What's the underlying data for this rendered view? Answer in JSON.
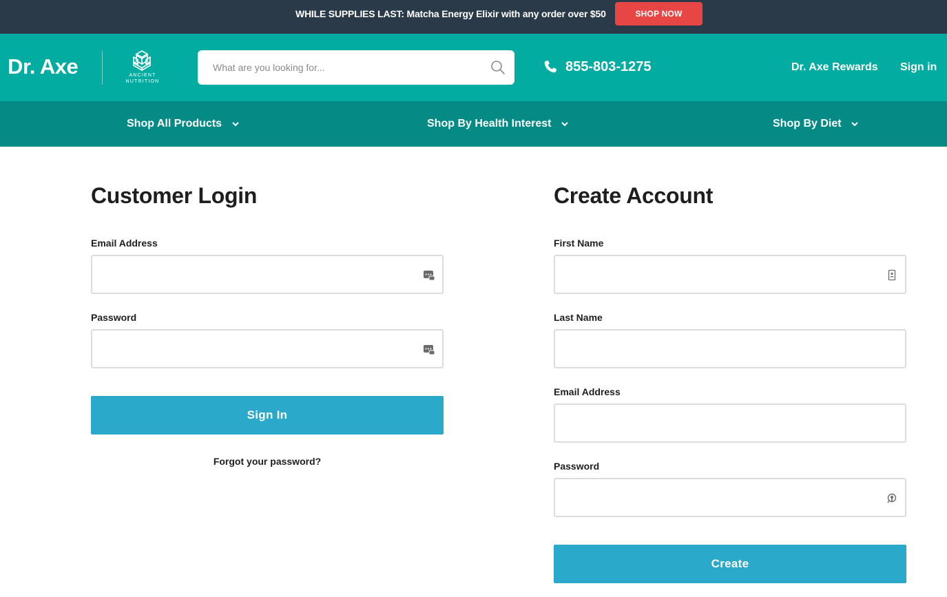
{
  "promo": {
    "text": "WHILE SUPPLIES LAST: Matcha Energy Elixir with any order over $50",
    "button_label": "SHOP NOW"
  },
  "header": {
    "logo": "Dr. Axe",
    "partner_logo_line1": "ANCIENT",
    "partner_logo_line2": "NUTRITION",
    "search_placeholder": "What are you looking for...",
    "phone": "855-803-1275",
    "rewards_link": "Dr. Axe Rewards",
    "signin_link": "Sign in"
  },
  "nav": {
    "items": [
      {
        "label": "Shop All Products"
      },
      {
        "label": "Shop By Health Interest"
      },
      {
        "label": "Shop By Diet"
      }
    ]
  },
  "login": {
    "title": "Customer Login",
    "email_label": "Email Address",
    "email_value": "",
    "password_label": "Password",
    "password_value": "",
    "submit_label": "Sign In",
    "forgot_label": "Forgot your password?"
  },
  "create": {
    "title": "Create Account",
    "first_name_label": "First Name",
    "first_name_value": "",
    "last_name_label": "Last Name",
    "last_name_value": "",
    "email_label": "Email Address",
    "email_value": "",
    "password_label": "Password",
    "password_value": "",
    "submit_label": "Create"
  },
  "icons": {
    "search": "search-icon",
    "phone": "phone-icon",
    "chevron": "chevron-down-icon",
    "password_manager": "password-manager-icon",
    "contact_card": "contact-card-icon",
    "key": "key-icon"
  },
  "colors": {
    "promo_bg": "#2b3a48",
    "promo_button": "#e84545",
    "header_bg": "#03aca0",
    "nav_bg": "#068a85",
    "button_bg": "#2aa9ca"
  }
}
